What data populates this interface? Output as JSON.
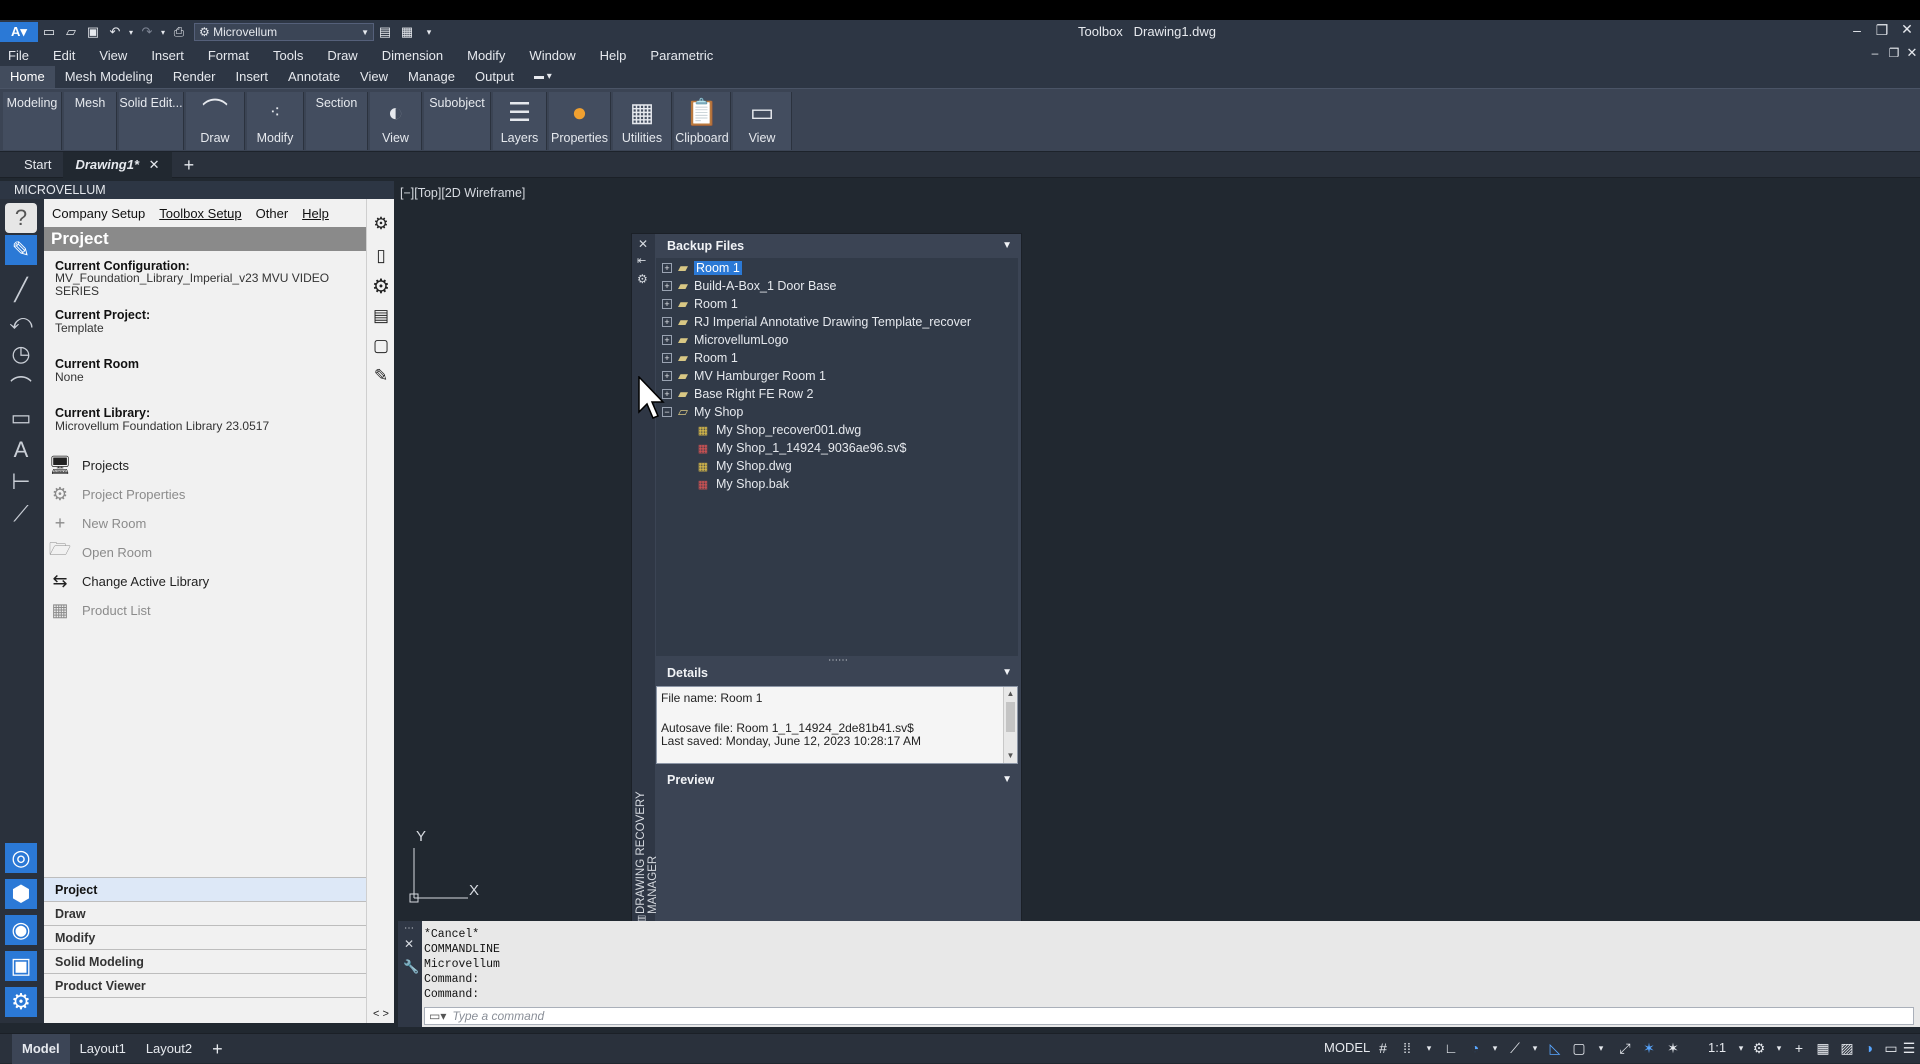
{
  "app": {
    "title": "Toolbox",
    "document": "Drawing1.dwg",
    "workspace": "Microvellum"
  },
  "menus": [
    "File",
    "Edit",
    "View",
    "Insert",
    "Format",
    "Tools",
    "Draw",
    "Dimension",
    "Modify",
    "Window",
    "Help",
    "Parametric"
  ],
  "ribbon_tabs": [
    "Home",
    "Mesh Modeling",
    "Render",
    "Insert",
    "Annotate",
    "View",
    "Manage",
    "Output"
  ],
  "ribbon_panels": {
    "modeling": "Modeling",
    "mesh": "Mesh",
    "solid_edit": "Solid Edit...",
    "draw": "Draw",
    "modify": "Modify",
    "section": "Section",
    "view1": "View",
    "subobject": "Subobject",
    "layers": "Layers",
    "properties": "Properties",
    "utilities": "Utilities",
    "clipboard": "Clipboard",
    "view2": "View"
  },
  "doc_tabs": {
    "start": "Start",
    "active": "Drawing1*"
  },
  "palette": {
    "title": "MICROVELLUM",
    "menu": [
      "Company Setup",
      "Toolbox Setup",
      "Other",
      "Help"
    ],
    "heading": "Project",
    "config_label": "Current Configuration:",
    "config_value": "MV_Foundation_Library_Imperial_v23 MVU VIDEO SERIES",
    "project_label": "Current Project:",
    "project_value": "Template",
    "room_label": "Current Room",
    "room_value": "None",
    "library_label": "Current Library:",
    "library_value": "Microvellum Foundation Library 23.0517",
    "actions": [
      "Projects",
      "Project Properties",
      "New Room",
      "Open Room",
      "Change Active Library",
      "Product List"
    ],
    "sections": [
      "Project",
      "Draw",
      "Modify",
      "Solid Modeling",
      "Product Viewer"
    ]
  },
  "viewport": {
    "control": "[−][Top][2D Wireframe]",
    "axis_x": "X",
    "axis_y": "Y"
  },
  "recovery": {
    "title": "DRAWING RECOVERY MANAGER",
    "backup_header": "Backup Files",
    "tree": [
      "Room 1",
      "Build-A-Box_1 Door Base",
      "Room 1",
      "RJ Imperial Annotative Drawing Template_recover",
      "MicrovellumLogo",
      "Room 1",
      "MV Hamburger Room 1",
      "Base Right FE Row 2",
      "My Shop"
    ],
    "children": [
      "My Shop_recover001.dwg",
      "My Shop_1_14924_9036ae96.sv$",
      "My Shop.dwg",
      "My Shop.bak"
    ],
    "details_header": "Details",
    "details": {
      "file_name": "File name: Room 1",
      "autosave": "Autosave file: Room 1_1_14924_2de81b41.sv$",
      "last_saved": "Last saved: Monday, June 12, 2023  10:28:17 AM"
    },
    "preview_header": "Preview"
  },
  "command": {
    "history": [
      "*Cancel*",
      "COMMANDLINE",
      "Microvellum",
      "Command:",
      "Command:"
    ],
    "placeholder": "Type a command"
  },
  "status": {
    "tabs": [
      "Model",
      "Layout1",
      "Layout2"
    ],
    "model": "MODEL",
    "scale": "1:1"
  }
}
